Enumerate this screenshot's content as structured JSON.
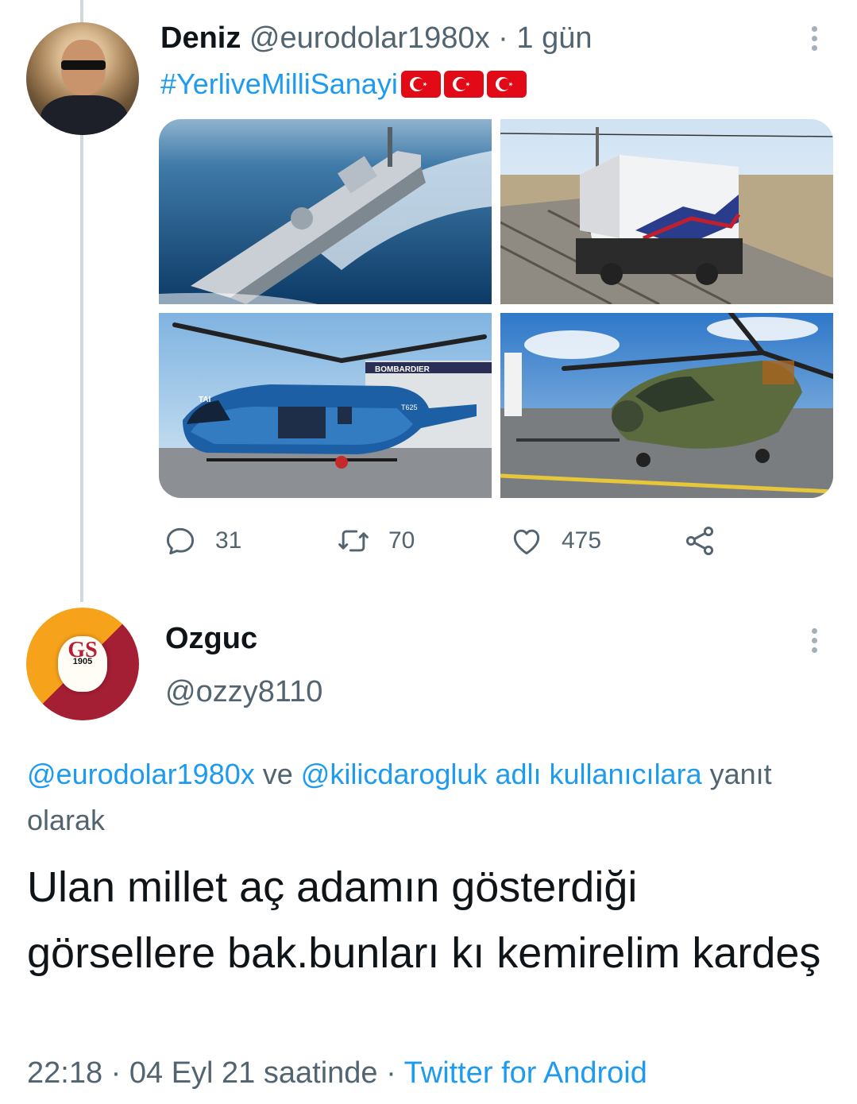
{
  "tweet": {
    "author_name": "Deniz",
    "author_handle": "@eurodolar1980x",
    "separator": "·",
    "time_ago": "1 gün",
    "hashtag": "#YerliveMilliSanayi",
    "flags": [
      "turkey-flag",
      "turkey-flag",
      "turkey-flag"
    ],
    "media": [
      "warship-image",
      "locomotive-image",
      "utility-helicopter-image",
      "attack-helicopter-image"
    ],
    "helicopter_labels": [
      "BOMBARDIER",
      "TAI",
      "T625"
    ],
    "actions": {
      "replies": "31",
      "retweets": "70",
      "likes": "475"
    }
  },
  "reply": {
    "author_name": "Ozguc",
    "author_handle": "@ozzy8110",
    "avatar_badge_text": "1905",
    "reply_to": {
      "mention_1": "@eurodolar1980x",
      "conjunction": "ve",
      "mention_2": "@kilicdarogluk",
      "suffix_link": "adlı kullanıcılara",
      "suffix": "yanıt olarak"
    },
    "text": "Ulan millet aç adamın gösterdiği görsellere bak.bunları kı kemirelim kardeş",
    "timestamp": "22:18",
    "separator": "·",
    "date": "04 Eyl 21 saatinde",
    "separator2": "·",
    "source": "Twitter for Android"
  },
  "colors": {
    "link": "#1d9bf0",
    "muted": "#536471",
    "text": "#0f1419",
    "thread_line": "#cfd9de"
  }
}
